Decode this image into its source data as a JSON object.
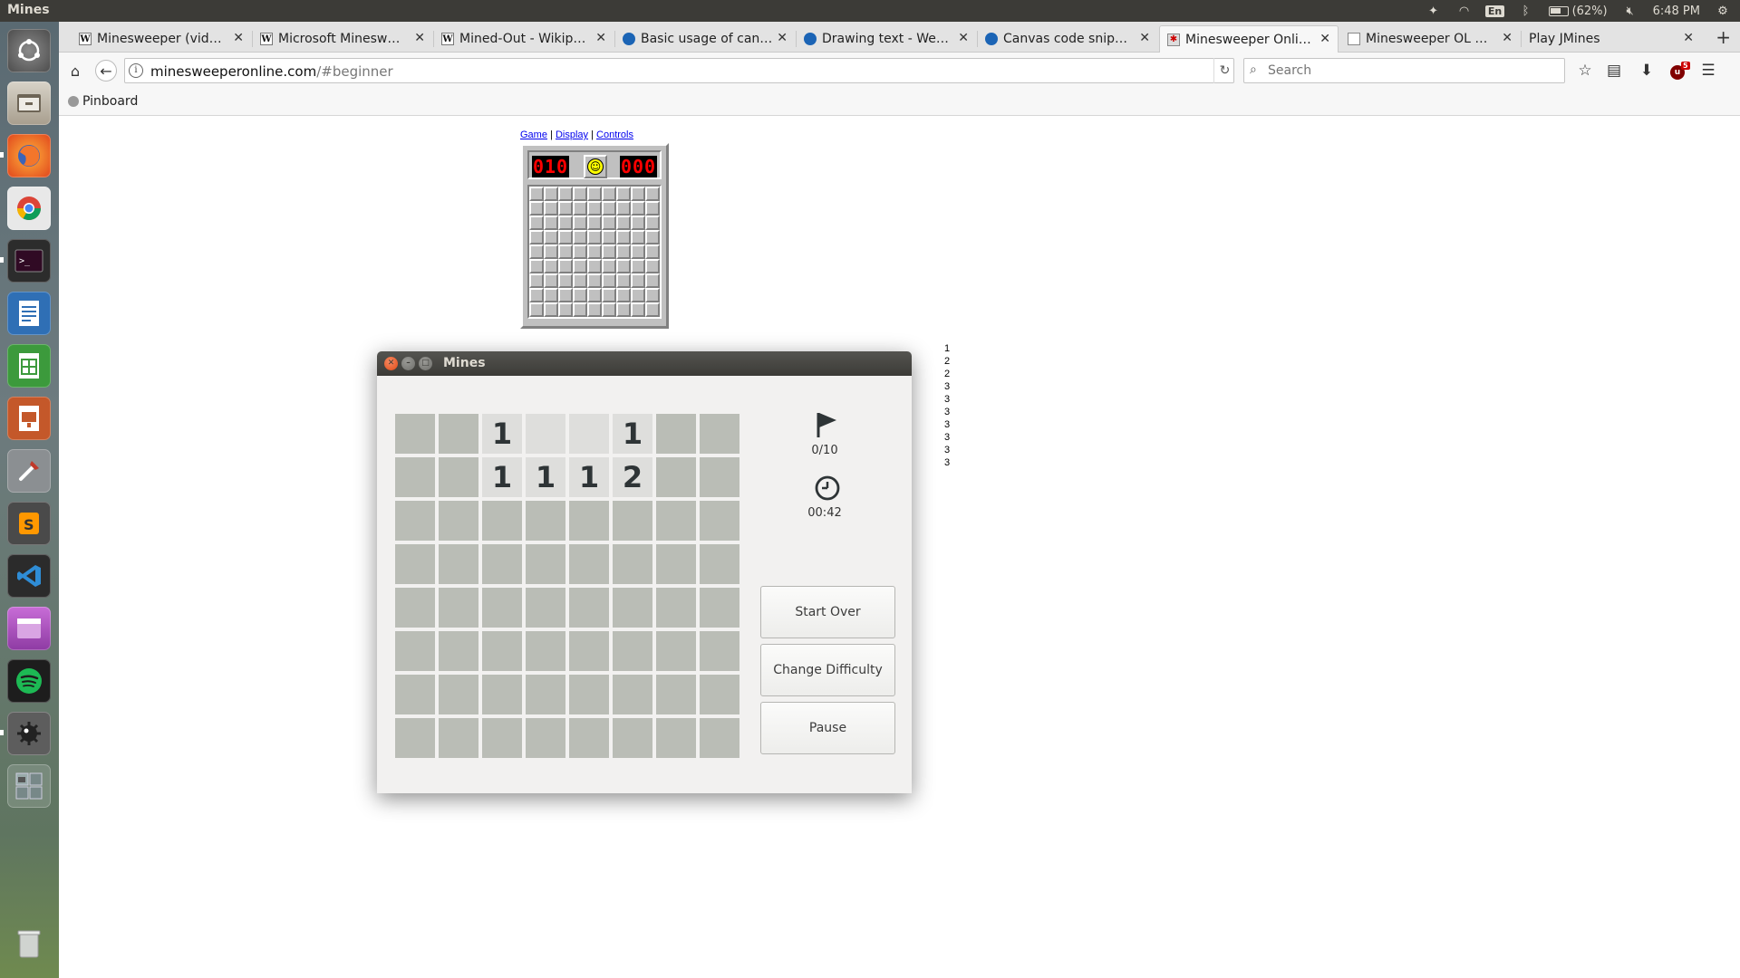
{
  "panel": {
    "app_title": "Mines",
    "lang": "En",
    "battery": "(62%)",
    "time": "6:48 PM"
  },
  "tabs": [
    {
      "label": "Minesweeper (vid…",
      "favicon": "wikipedia-icon",
      "fav_glyph": "W"
    },
    {
      "label": "Microsoft Minesw…",
      "favicon": "wikipedia-icon",
      "fav_glyph": "W"
    },
    {
      "label": "Mined-Out - Wikip…",
      "favicon": "wikipedia-icon",
      "fav_glyph": "W"
    },
    {
      "label": "Basic usage of can…",
      "favicon": "mdn-icon",
      "fav_glyph": "●"
    },
    {
      "label": "Drawing text - We…",
      "favicon": "mdn-icon",
      "fav_glyph": "●"
    },
    {
      "label": "Canvas code snip…",
      "favicon": "mdn-icon",
      "fav_glyph": "●"
    },
    {
      "label": "Minesweeper Onli…",
      "favicon": "minesweeper-icon",
      "fav_glyph": "✱",
      "active": true
    },
    {
      "label": "Minesweeper OL …",
      "favicon": "page-icon",
      "fav_glyph": ""
    },
    {
      "label": "Play JMines",
      "favicon": "",
      "fav_glyph": ""
    }
  ],
  "address": {
    "host": "minesweeperonline.com",
    "path": "/#beginner"
  },
  "search": {
    "placeholder": "Search"
  },
  "bookmarks": {
    "pinboard": "Pinboard"
  },
  "ms_online": {
    "menu": {
      "game": "Game",
      "sep1": " | ",
      "display": "Display",
      "sep2": " | ",
      "controls": "Controls"
    },
    "mines_left": "010",
    "timer": "000",
    "smiley": "☺",
    "rows": 9,
    "cols": 9
  },
  "side_list": [
    "1",
    "2",
    "2",
    "3",
    "3",
    "3",
    "3",
    "3",
    "3",
    "3"
  ],
  "mines_window": {
    "title": "Mines",
    "grid": [
      [
        "",
        "",
        "1",
        " ",
        " ",
        "1",
        "",
        ""
      ],
      [
        "",
        "",
        "1",
        "1",
        "1",
        "2",
        "",
        ""
      ],
      [
        "",
        "",
        "",
        "",
        "",
        "",
        "",
        ""
      ],
      [
        "",
        "",
        "",
        "",
        "",
        "",
        "",
        ""
      ],
      [
        "",
        "",
        "",
        "",
        "",
        "",
        "",
        ""
      ],
      [
        "",
        "",
        "",
        "",
        "",
        "",
        "",
        ""
      ],
      [
        "",
        "",
        "",
        "",
        "",
        "",
        "",
        ""
      ],
      [
        "",
        "",
        "",
        "",
        "",
        "",
        "",
        ""
      ]
    ],
    "revealed": [
      [
        false,
        false,
        true,
        true,
        true,
        true,
        false,
        false
      ],
      [
        false,
        false,
        true,
        true,
        true,
        true,
        false,
        false
      ],
      [
        false,
        false,
        false,
        false,
        false,
        false,
        false,
        false
      ],
      [
        false,
        false,
        false,
        false,
        false,
        false,
        false,
        false
      ],
      [
        false,
        false,
        false,
        false,
        false,
        false,
        false,
        false
      ],
      [
        false,
        false,
        false,
        false,
        false,
        false,
        false,
        false
      ],
      [
        false,
        false,
        false,
        false,
        false,
        false,
        false,
        false
      ],
      [
        false,
        false,
        false,
        false,
        false,
        false,
        false,
        false
      ]
    ],
    "flags": "0/10",
    "time": "00:42",
    "buttons": {
      "start_over": "Start Over",
      "change_difficulty": "Change Difficulty",
      "pause": "Pause"
    }
  },
  "colors": {
    "unrevealed_cell": "#babdb6",
    "revealed_cell": "#dededc",
    "panel": "#3c3b37",
    "close_button": "#df4a16",
    "led_red": "#ff0000"
  }
}
